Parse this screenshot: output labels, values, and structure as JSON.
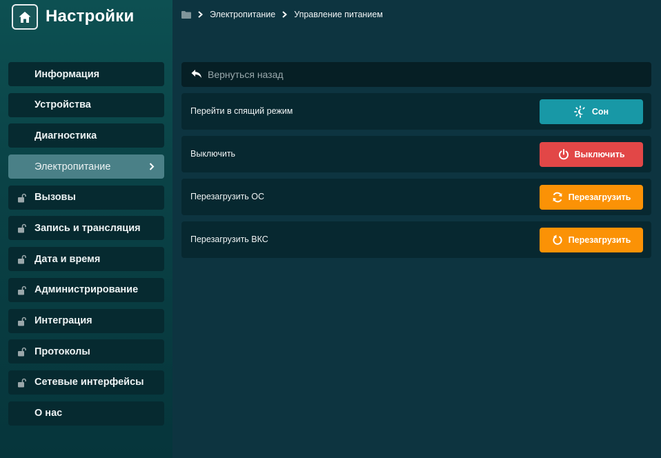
{
  "app": {
    "title": "Настройки"
  },
  "breadcrumb": {
    "items": [
      "Электропитание",
      "Управление питанием"
    ]
  },
  "sidebar": {
    "items": [
      {
        "label": "Информация",
        "locked": false,
        "active": false
      },
      {
        "label": "Устройства",
        "locked": false,
        "active": false
      },
      {
        "label": "Диагностика",
        "locked": false,
        "active": false
      },
      {
        "label": "Электропитание",
        "locked": false,
        "active": true
      },
      {
        "label": "Вызовы",
        "locked": true,
        "active": false
      },
      {
        "label": "Запись и трансляция",
        "locked": true,
        "active": false
      },
      {
        "label": "Дата и время",
        "locked": true,
        "active": false
      },
      {
        "label": "Администрирование",
        "locked": true,
        "active": false
      },
      {
        "label": "Интеграция",
        "locked": true,
        "active": false
      },
      {
        "label": "Протоколы",
        "locked": true,
        "active": false
      },
      {
        "label": "Сетевые интерфейсы",
        "locked": true,
        "active": false
      },
      {
        "label": "О нас",
        "locked": false,
        "active": false
      }
    ]
  },
  "main": {
    "back_label": "Вернуться назад",
    "rows": [
      {
        "label": "Перейти в спящий режим",
        "button": "Сон",
        "icon": "sleep-icon",
        "color": "#1898a6"
      },
      {
        "label": "Выключить",
        "button": "Выключить",
        "icon": "power-icon",
        "color": "#e24747"
      },
      {
        "label": "Перезагрузить ОС",
        "button": "Перезагрузить",
        "icon": "refresh-icon",
        "color": "#fb9206"
      },
      {
        "label": "Перезагрузить ВКС",
        "button": "Перезагрузить",
        "icon": "restart-icon",
        "color": "#fb9206"
      }
    ]
  }
}
